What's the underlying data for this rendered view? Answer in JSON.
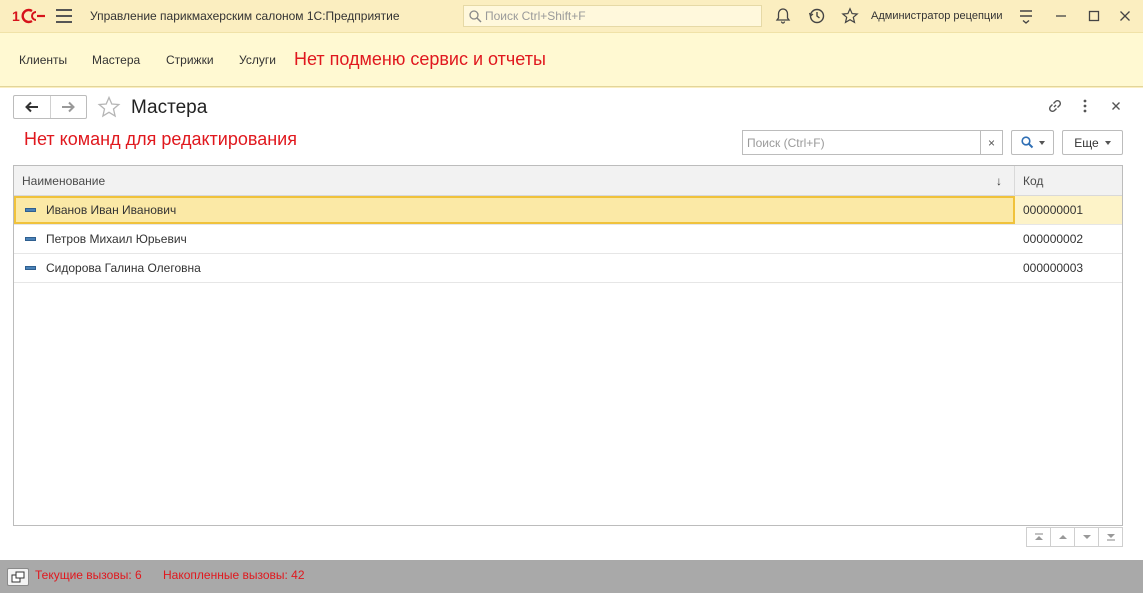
{
  "titlebar": {
    "app_title": "Управление парикмахерским салоном 1С:Предприятие",
    "search_placeholder": "Поиск Ctrl+Shift+F",
    "user": "Администратор рецепции"
  },
  "sections": {
    "items": [
      {
        "label": "Клиенты"
      },
      {
        "label": "Мастера"
      },
      {
        "label": "Стрижки"
      },
      {
        "label": "Услуги"
      }
    ],
    "note": "Нет подменю сервис и отчеты"
  },
  "form": {
    "title": "Мастера",
    "note": "Нет команд для редактирования",
    "search_placeholder": "Поиск (Ctrl+F)",
    "clear_label": "×",
    "more_label": "Еще"
  },
  "table": {
    "columns": {
      "name": "Наименование",
      "code": "Код"
    },
    "sort_indicator": "↓",
    "rows": [
      {
        "name": "Иванов Иван Иванович",
        "code": "000000001"
      },
      {
        "name": "Петров Михаил Юрьевич",
        "code": "000000002"
      },
      {
        "name": "Сидорова Галина Олеговна",
        "code": "000000003"
      }
    ]
  },
  "status": {
    "current_calls": "Текущие вызовы: 6",
    "accumulated_calls": "Накопленные вызовы: 42"
  },
  "colors": {
    "accent_red": "#e0181e",
    "titlebar_bg": "#fbeec0",
    "selection_bg": "#fbe9a6",
    "selection_border": "#f0c23b"
  }
}
